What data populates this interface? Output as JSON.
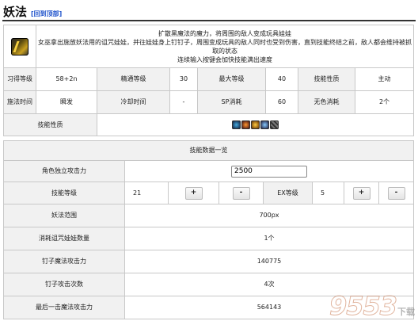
{
  "header": {
    "title": "妖法",
    "back_link": "回到顶部"
  },
  "skill": {
    "icon": "wand-skill-icon",
    "description": [
      "扩散黑魔法的魔力，将周围的敌人变成玩具娃娃",
      "女巫拿出施放妖法用的诅咒娃娃，并往娃娃身上钉钉子，周围变成玩具的敌人同时也受到伤害，直到技能终结之前，敌人都会维持被抓取的状态",
      "连续输入按键会加快技能满出速度"
    ]
  },
  "info": {
    "row1": {
      "learn_level_label": "习得等级",
      "learn_level_value": "58+2n",
      "mastery_label": "精通等级",
      "mastery_value": "30",
      "max_label": "最大等级",
      "max_value": "40",
      "skill_nature_label": "技能性质",
      "skill_nature_value": "主动"
    },
    "row2": {
      "cast_time_label": "施法时间",
      "cast_time_value": "瞬发",
      "cooldown_label": "冷却时间",
      "cooldown_value": "-",
      "sp_label": "SP消耗",
      "sp_value": "60",
      "mp_label": "无色消耗",
      "mp_value": "2个"
    },
    "attribute_label": "技能性质",
    "attribute_icons": [
      "frost-icon",
      "fire-icon",
      "swirl-icon",
      "lightning-icon",
      "grid-icon"
    ]
  },
  "data_section": {
    "title": "技能数据一览",
    "atk_label": "角色独立攻击力",
    "atk_value": "2500",
    "level_label": "技能等级",
    "level_value": "21",
    "ex_label": "EX等级",
    "ex_value": "5",
    "plus": "+",
    "minus": "-",
    "rows": [
      {
        "label": "妖法范围",
        "value": "700px"
      },
      {
        "label": "消耗诅咒娃娃数量",
        "value": "1个"
      },
      {
        "label": "钉子魔法攻击力",
        "value": "140775"
      },
      {
        "label": "钉子攻击次数",
        "value": "4次"
      },
      {
        "label": "最后一击魔法攻击力",
        "value": "564143"
      }
    ]
  },
  "watermark": {
    "number": "9553",
    "text": "下载"
  }
}
